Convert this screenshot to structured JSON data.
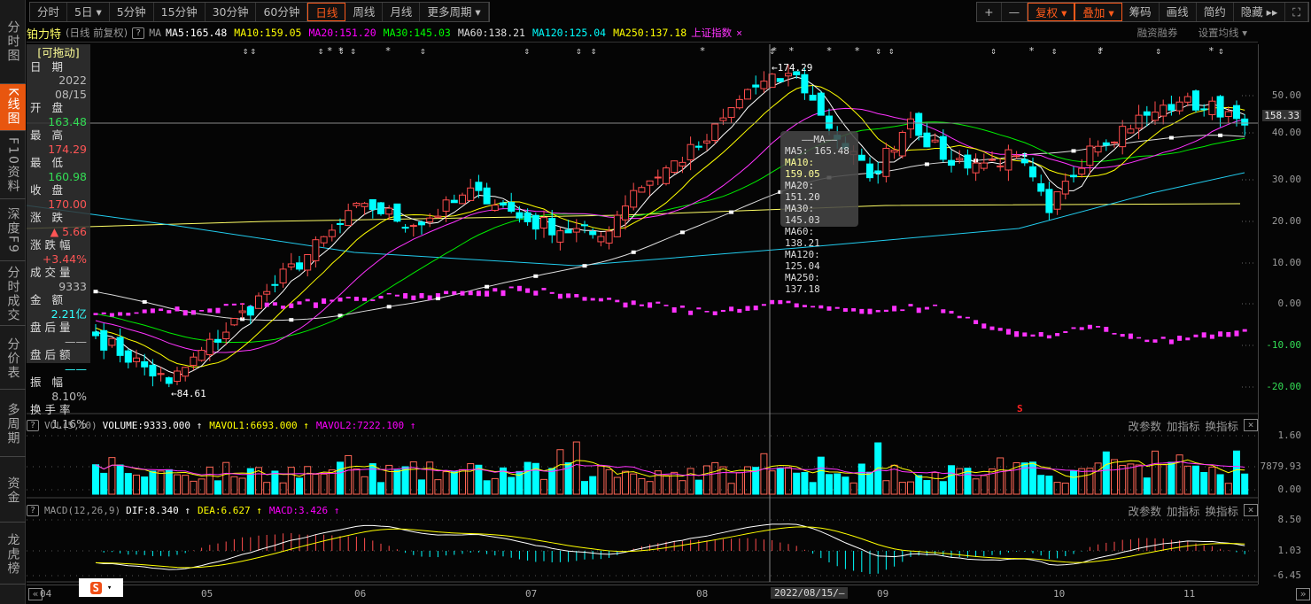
{
  "sidebar": [
    "分时图",
    "K线图",
    "F10资料",
    "深度F9",
    "分时成交",
    "分价表",
    "多周期",
    "资金",
    "龙虎榜"
  ],
  "toolbar": {
    "periods": [
      "分时",
      "5日 ▾",
      "5分钟",
      "15分钟",
      "30分钟",
      "60分钟",
      "日线",
      "周线",
      "月线",
      "更多周期 ▾"
    ],
    "active": "日线",
    "right": [
      "+",
      "—",
      "复权 ▾",
      "叠加 ▾",
      "筹码",
      "画线",
      "简约",
      "隐藏 ▸▸",
      "⛶"
    ]
  },
  "info": {
    "stock": "铂力特",
    "mode": "(日线 前复权)",
    "help": "?",
    "ma_label": "MA",
    "ma": [
      {
        "t": "MA5:165.48",
        "c": "#ffffff"
      },
      {
        "t": "MA10:159.05",
        "c": "#ffff00"
      },
      {
        "t": "MA20:151.20",
        "c": "#ff00ff"
      },
      {
        "t": "MA30:145.03",
        "c": "#00ff00"
      },
      {
        "t": "MA60:138.21",
        "c": "#dddddd"
      },
      {
        "t": "MA120:125.04",
        "c": "#00ffff"
      },
      {
        "t": "MA250:137.18",
        "c": "#ffff00"
      }
    ],
    "overlay": "上证指数",
    "close_x": "×",
    "margin": "融资融券",
    "set_ma": "设置均线 ▾"
  },
  "datapanel": {
    "drag": "[可拖动]",
    "rows": [
      {
        "l": "日 期",
        "v": "2022\n08/15",
        "c": "#bbb"
      },
      {
        "l": "开 盘",
        "v": "163.48",
        "c": "#33dd55"
      },
      {
        "l": "最 高",
        "v": "174.29",
        "c": "#ff5555"
      },
      {
        "l": "最 低",
        "v": "160.98",
        "c": "#33dd55"
      },
      {
        "l": "收 盘",
        "v": "170.00",
        "c": "#ff5555"
      },
      {
        "l": "涨 跌",
        "v": "▲ 5.66",
        "c": "#ff5555"
      },
      {
        "l": "涨跌幅",
        "v": "+3.44%",
        "c": "#ff5555"
      },
      {
        "l": "成交量",
        "v": "9333",
        "c": "#bbb"
      },
      {
        "l": "金 额",
        "v": "2.21亿",
        "c": "#33ffff"
      },
      {
        "l": "盘后量",
        "v": "——",
        "c": "#bbb"
      },
      {
        "l": "盘后额",
        "v": "——",
        "c": "#33ffff"
      },
      {
        "l": "振 幅",
        "v": "8.10%",
        "c": "#bbb"
      },
      {
        "l": "换手率",
        "v": "1.16%",
        "c": "#bbb"
      }
    ]
  },
  "axis": {
    "main": [
      "50.00",
      "40.00",
      "30.00",
      "20.00",
      "10.00",
      "0.00",
      "-10.00",
      "-20.00"
    ],
    "current": "158.33",
    "vol": [
      "1.60",
      "7879.93",
      "0.00"
    ],
    "macd": [
      "8.50",
      "1.03",
      "-6.45"
    ]
  },
  "tooltip": {
    "title": "——MA——",
    "rows": [
      "MA5: 165.48",
      "MA10: 159.05",
      "MA20: 151.20",
      "MA30: 145.03",
      "MA60: 138.21",
      "MA120: 125.04",
      "MA250: 137.18"
    ]
  },
  "annotations": {
    "high": "←174.29",
    "low": "←84.61",
    "s_mark": "S"
  },
  "vol": {
    "help": "?",
    "name": "VOL(5,10)",
    "items": [
      {
        "t": "VOLUME:9333.000 ↑",
        "c": "#ffffff"
      },
      {
        "t": "MAVOL1:6693.000 ↑",
        "c": "#ffff00"
      },
      {
        "t": "MAVOL2:7222.100 ↑",
        "c": "#ff00ff"
      }
    ],
    "btns": [
      "改参数",
      "加指标",
      "换指标"
    ],
    "close": "×"
  },
  "macd": {
    "help": "?",
    "name": "MACD(12,26,9)",
    "items": [
      {
        "t": "DIF:8.340 ↑",
        "c": "#ffffff"
      },
      {
        "t": "DEA:6.627 ↑",
        "c": "#ffff00"
      },
      {
        "t": "MACD:3.426 ↑",
        "c": "#ff00ff"
      }
    ],
    "btns": [
      "改参数",
      "加指标",
      "换指标"
    ],
    "close": "×"
  },
  "dateaxis": {
    "months": [
      "04",
      "05",
      "06",
      "07",
      "08",
      "09",
      "10",
      "11"
    ],
    "cursor": "2022/08/15/—",
    "prev": "«",
    "next": "»"
  },
  "colors": {
    "up": "#ff4d4d",
    "down": "#00ffff",
    "accent": "#e8560f"
  },
  "chart_data": {
    "type": "candlestick",
    "note_series": "close key points (trading day index, price)",
    "close_keypoints": [
      [
        0,
        101
      ],
      [
        9,
        88
      ],
      [
        21,
        113
      ],
      [
        33,
        137
      ],
      [
        39,
        131
      ],
      [
        47,
        140.5
      ],
      [
        53,
        132
      ],
      [
        62,
        128
      ],
      [
        66,
        140.5
      ],
      [
        75,
        154
      ],
      [
        80,
        168
      ],
      [
        86,
        172
      ],
      [
        89,
        161
      ],
      [
        95,
        144
      ],
      [
        100,
        160
      ],
      [
        104,
        149
      ],
      [
        109,
        148
      ],
      [
        113,
        150
      ],
      [
        117,
        134.5
      ],
      [
        122,
        152.6
      ],
      [
        129,
        161
      ],
      [
        133,
        164.6
      ],
      [
        139,
        162
      ],
      [
        141,
        158.33
      ]
    ],
    "high": 174.29,
    "low": 84.61
  }
}
